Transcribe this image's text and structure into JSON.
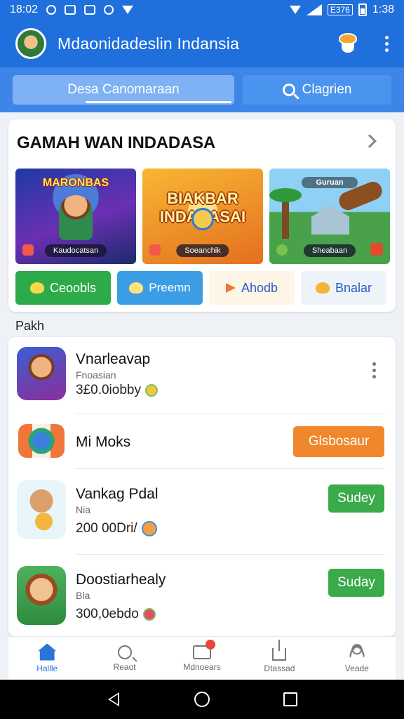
{
  "status": {
    "time_left": "18:02",
    "network": "E376",
    "time_right": "1:38"
  },
  "appbar": {
    "title": "Mdaonidadeslin Indansia",
    "icons": [
      "avatar",
      "cup-icon",
      "more-icon"
    ]
  },
  "tabs": {
    "primary": "Desa Canomaraan",
    "search": "Clagrien"
  },
  "featured": {
    "heading": "GAMAH WAN INDADASA",
    "games": [
      {
        "title": "MARONBAS",
        "caption": "Kaudocatsan"
      },
      {
        "title": "BIAKBAR INDANASAI",
        "caption": "Soeanchik"
      },
      {
        "title": "Guruan",
        "caption": "Sheabaan"
      }
    ],
    "pills": [
      "Ceoobls",
      "Preemn",
      "Ahodb",
      "Bnalar"
    ]
  },
  "section_label": "Pakh",
  "list": [
    {
      "title": "Vnarleavap",
      "sub": "Fnoasian",
      "price": "3£0.0iobby",
      "action": ""
    },
    {
      "title": "Mi Moks",
      "sub": "",
      "price": "",
      "action": "Glsbosaur"
    },
    {
      "title": "Vankag Pdal",
      "sub": "Nia",
      "price": "200 00Dri/",
      "action": "Sudey"
    },
    {
      "title": "Doostiarhealy",
      "sub": "Bla",
      "price": "300,0ebdo",
      "action": "Suday"
    }
  ],
  "bottom_nav": [
    {
      "label": "Hallle",
      "icon": "home-icon",
      "active": true
    },
    {
      "label": "Reaot",
      "icon": "search-icon",
      "active": false
    },
    {
      "label": "Mdnoears",
      "icon": "message-icon",
      "active": false
    },
    {
      "label": "Dtassad",
      "icon": "share-icon",
      "active": false
    },
    {
      "label": "Veade",
      "icon": "user-icon",
      "active": false
    }
  ],
  "colors": {
    "primary": "#1f6fdc",
    "accent_orange": "#f0872c",
    "accent_green": "#3aaa4b"
  }
}
